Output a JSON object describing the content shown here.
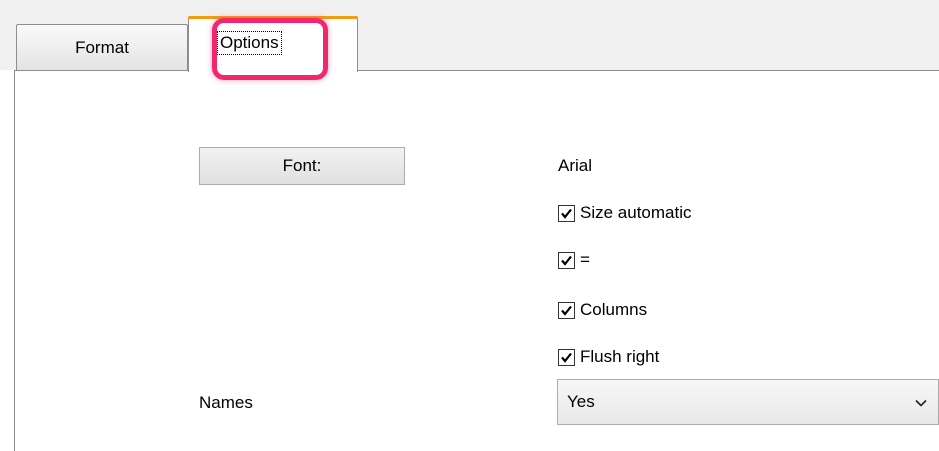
{
  "tabs": [
    {
      "label": "Format"
    },
    {
      "label": "Options"
    }
  ],
  "font": {
    "button_label": "Font:",
    "value": "Arial"
  },
  "checkboxes": [
    {
      "label": "Size automatic",
      "checked": true
    },
    {
      "label": "=",
      "checked": true
    },
    {
      "label": "Columns",
      "checked": true
    },
    {
      "label": "Flush right",
      "checked": true
    }
  ],
  "names": {
    "label": "Names",
    "selected": "Yes"
  },
  "colors": {
    "active_tab_accent": "#f39c12",
    "highlight": "#f2286e"
  }
}
